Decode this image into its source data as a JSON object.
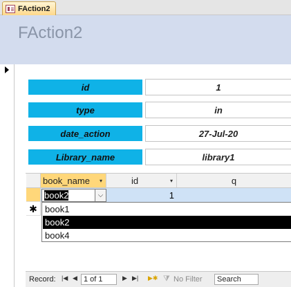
{
  "tab": {
    "title": "FAction2",
    "icon": "form-icon"
  },
  "form": {
    "title": "FAction2"
  },
  "fields": [
    {
      "label": "id",
      "value": "1"
    },
    {
      "label": "type",
      "value": "in"
    },
    {
      "label": "date_action",
      "value": "27-Jul-20"
    },
    {
      "label": "Library_name",
      "value": "library1"
    }
  ],
  "subform": {
    "columns": [
      "book_name",
      "id",
      "q"
    ],
    "sort_arrow": "▾",
    "current_row": {
      "book_name": "book2",
      "id": "1",
      "q": ""
    },
    "new_row_marker": "✱",
    "dropdown_options": [
      "book1",
      "book2",
      "book4"
    ],
    "dropdown_selected": "book2",
    "combo_arrow": "⌵"
  },
  "navigation": {
    "record_label": "Record:",
    "first": "|◀",
    "prev": "◀",
    "position": "1 of 1",
    "next": "▶",
    "last": "▶|",
    "new": "▶✱",
    "filter_status": "No Filter",
    "search_placeholder": "Search"
  }
}
